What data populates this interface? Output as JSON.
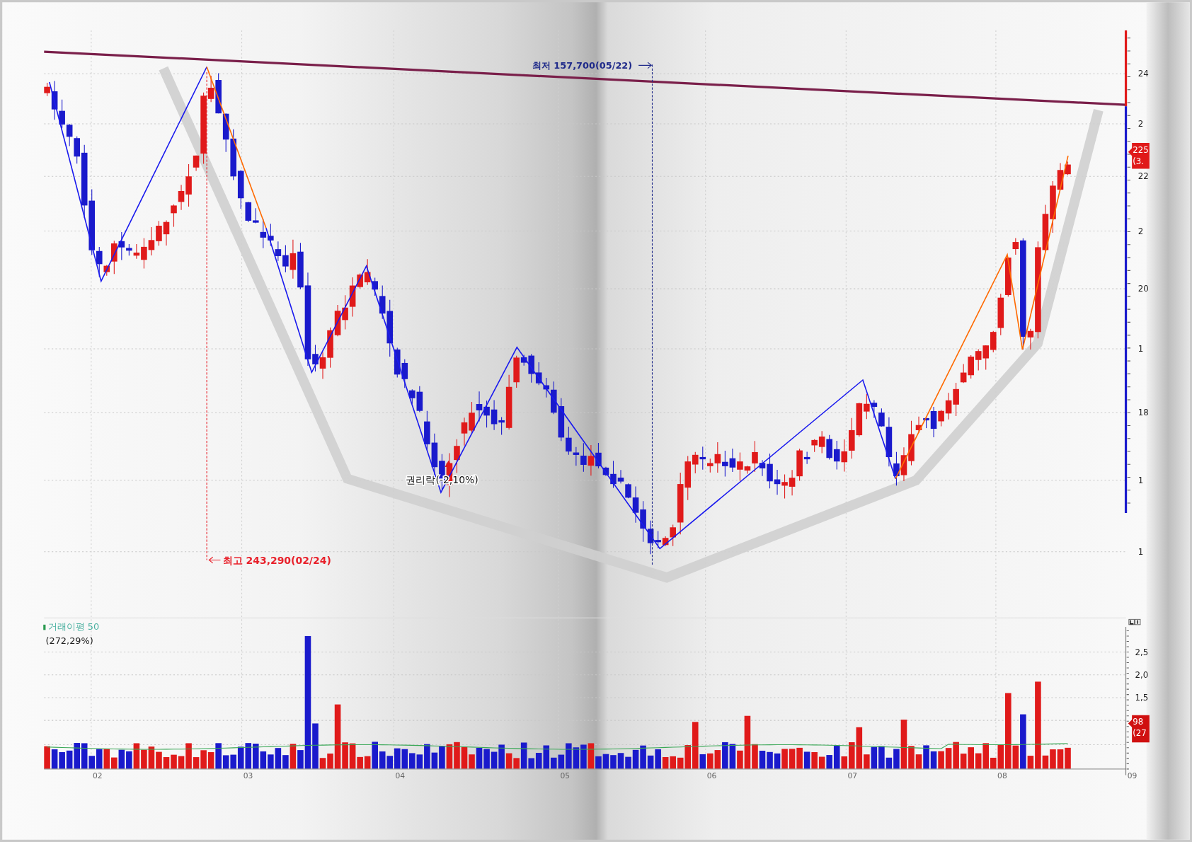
{
  "price_panel": {
    "annotations": [
      {
        "kind": "high",
        "text": "최고 243,290(02/24)"
      },
      {
        "kind": "low",
        "text": "최저 157,700(05/22)"
      },
      {
        "kind": "event",
        "text": "권리락(-2,10%)"
      }
    ],
    "y_axis_labels": [
      "24",
      "2",
      "22",
      "2",
      "20",
      "1",
      "18",
      "1",
      "1"
    ],
    "price_tag": [
      "225",
      "(3."
    ]
  },
  "volume_panel": {
    "legend": "거래이평 50",
    "legend_value": "(272,29%)",
    "y_axis_labels": [
      "2,5",
      "2,0",
      "1,5"
    ],
    "volume_tag": [
      "98",
      "(27"
    ]
  },
  "x_axis_labels": [
    "02",
    "03",
    "04",
    "05",
    "06",
    "07",
    "08",
    "09"
  ]
}
